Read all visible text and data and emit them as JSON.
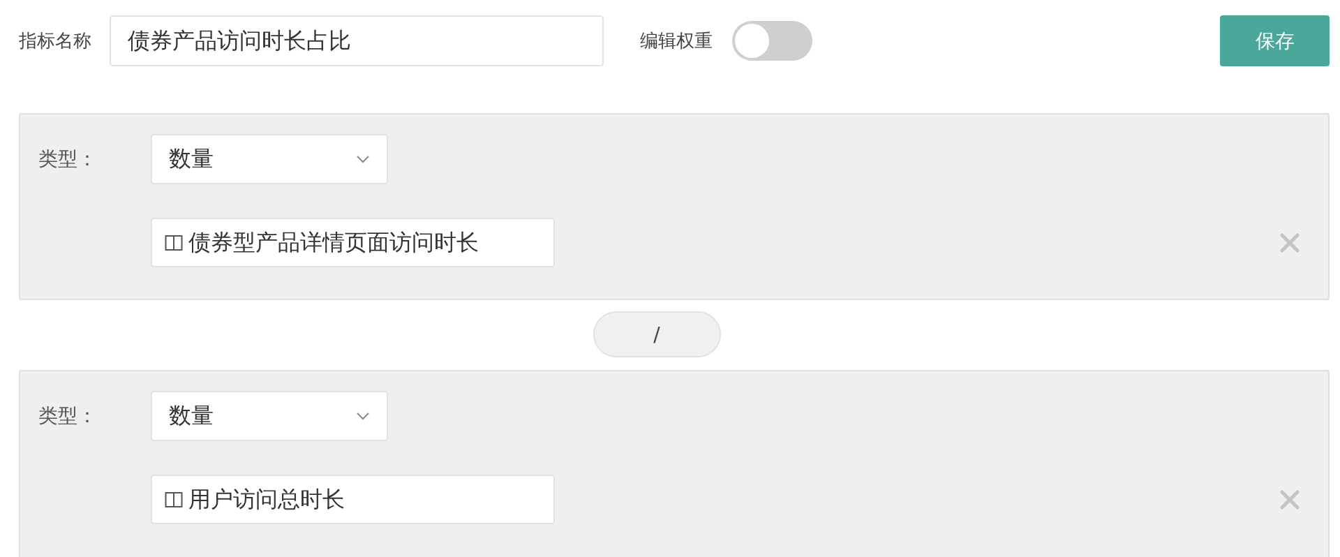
{
  "metric_name": {
    "label": "指标名称",
    "value": "债券产品访问时长占比"
  },
  "edit_weight": {
    "label": "编辑权重",
    "on": false
  },
  "save_button": "保存",
  "operands": [
    {
      "type_label": "类型：",
      "type_value": "数量",
      "item": "债券型产品详情页面访问时长"
    },
    {
      "type_label": "类型：",
      "type_value": "数量",
      "item": "用户访问总时长"
    }
  ],
  "operator": "/"
}
